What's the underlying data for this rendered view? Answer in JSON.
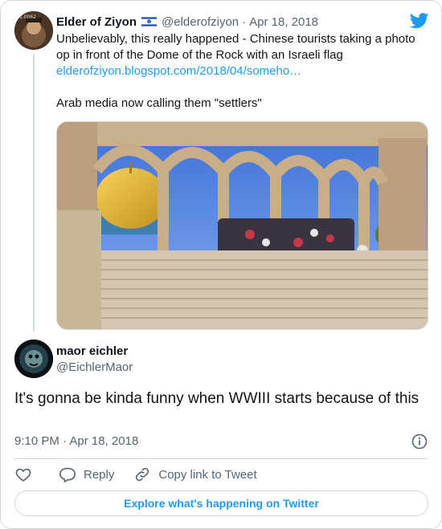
{
  "quoted_tweet": {
    "author_name": "Elder of Ziyon",
    "flag_icon": "israel-flag-icon",
    "handle": "@elderofziyon",
    "separator": "·",
    "date": "Apr 18, 2018",
    "text_lines": [
      "Unbelievably, this really happened - Chinese tourists taking a photo",
      "op in front of the Dome of the Rock with an Israeli flag"
    ],
    "link_text": "elderofziyon.blogspot.com/2018/04/someho…",
    "text_line_2": "Arab media now calling them \"settlers\"",
    "photo_icon": "temple-mount-photo"
  },
  "reply": {
    "author_name": "maor eichler",
    "handle": "@EichlerMaor",
    "text": "It's gonna be kinda funny when WWIII starts because of this",
    "time": "9:10 PM",
    "separator": "·",
    "date": "Apr 18, 2018"
  },
  "actions": {
    "reply_label": "Reply",
    "copy_label": "Copy link to Tweet"
  },
  "explore_label": "Explore what's happening on Twitter",
  "colors": {
    "accent": "#1d9bf0",
    "muted": "#536471",
    "border": "#cfd9de"
  }
}
